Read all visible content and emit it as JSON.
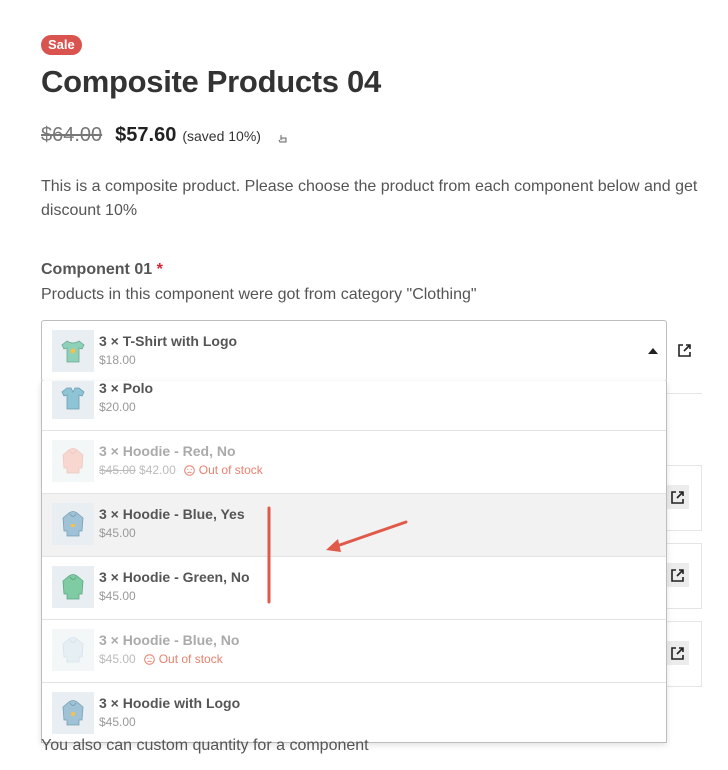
{
  "product": {
    "badge": "Sale",
    "title": "Composite Products 04",
    "old_price": "$64.00",
    "new_price": "$57.60",
    "saved": "(saved 10%)",
    "description": "This is a composite product. Please choose the product from each component below and get discount 10%"
  },
  "component": {
    "title": "Component 01",
    "required_mark": "*",
    "description": "Products in this component were got from category \"Clothing\"",
    "selected": {
      "name": "3 × T-Shirt with Logo",
      "price": "$18.00",
      "thumb_icon": "tshirt-icon"
    },
    "options": [
      {
        "name": "3 × Polo",
        "price": "$20.00",
        "thumb_icon": "polo-icon",
        "color": "#8fc3d6"
      },
      {
        "name": "3 × Hoodie - Red, No",
        "old_price": "$45.00",
        "price": "$42.00",
        "stock": "Out of stock",
        "thumb_icon": "hoodie-icon",
        "color": "#f3a79a"
      },
      {
        "name": "3 × Hoodie - Blue, Yes",
        "price": "$45.00",
        "thumb_icon": "hoodie-icon",
        "color": "#9fc2d6"
      },
      {
        "name": "3 × Hoodie - Green, No",
        "price": "$45.00",
        "thumb_icon": "hoodie-icon",
        "color": "#7fcba4"
      },
      {
        "name": "3 × Hoodie - Blue, No",
        "price": "$45.00",
        "stock": "Out of stock",
        "thumb_icon": "hoodie-icon",
        "color": "#c7dde8"
      },
      {
        "name": "3 × Hoodie with Logo",
        "price": "$45.00",
        "thumb_icon": "hoodie-icon",
        "color": "#9fc2d6"
      }
    ]
  },
  "footer_text": "You also can custom quantity for a component",
  "colors": {
    "sale_badge": "#d9534f",
    "required": "#d9232e",
    "out_of_stock": "#e8806f",
    "annotation": "#e05a4a"
  }
}
